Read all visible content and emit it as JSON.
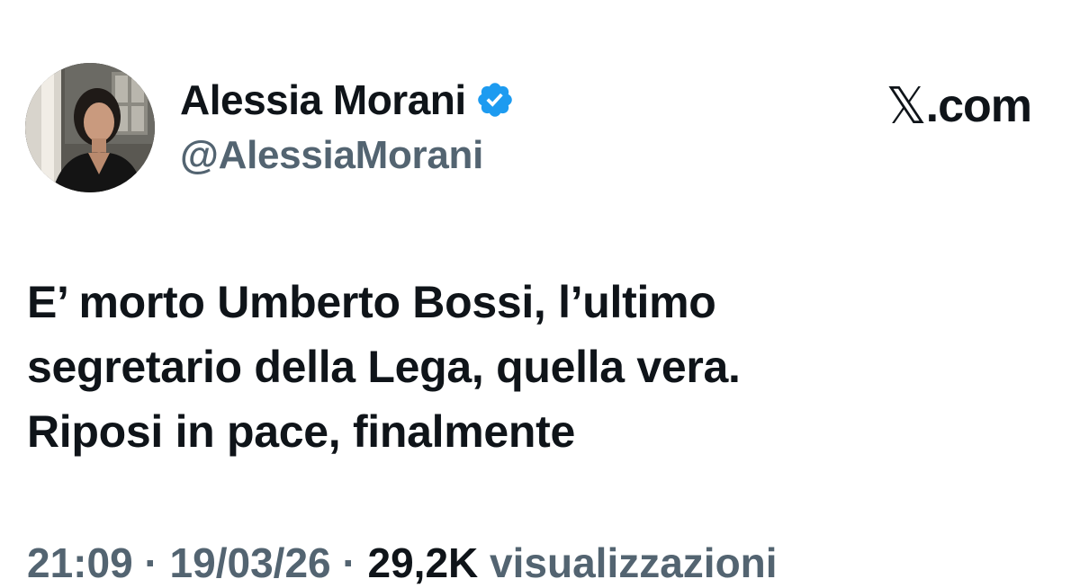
{
  "author": {
    "display_name": "Alessia Morani",
    "handle": "@AlessiaMorani",
    "verified": true,
    "verified_color": "#1d9bf0"
  },
  "brand": {
    "x_symbol": "𝕏",
    "domain": ".com"
  },
  "tweet": {
    "lines": [
      "E’ morto Umberto Bossi, l’ultimo",
      "segretario della Lega, quella vera.",
      "Riposi in pace, finalmente"
    ]
  },
  "meta": {
    "time": "21:09",
    "separator": " · ",
    "date": "19/03/26",
    "views_count": "29,2K",
    "views_label": " visualizzazioni"
  },
  "colors": {
    "text_primary": "#0f1419",
    "text_secondary": "#536471",
    "background": "#ffffff"
  }
}
